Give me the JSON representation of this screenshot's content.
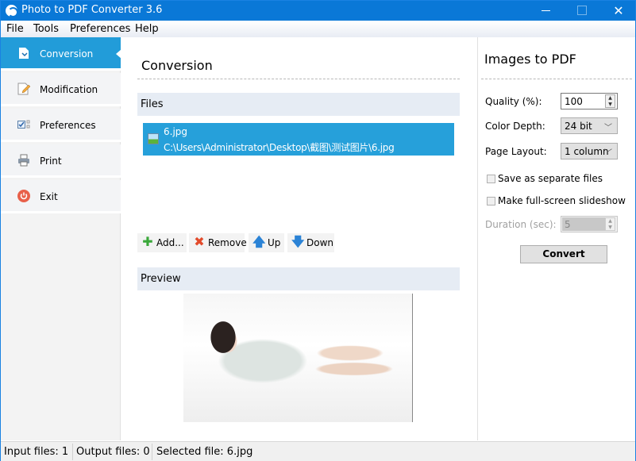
{
  "window": {
    "title": "Photo to PDF Converter 3.6",
    "controls": {
      "minimize": "minimize",
      "maximize": "maximize",
      "close": "✕"
    }
  },
  "menu": [
    "File",
    "Tools",
    "Preferences",
    "Help"
  ],
  "sidebar": {
    "items": [
      {
        "label": "Conversion",
        "icon": "document-convert-icon",
        "active": true
      },
      {
        "label": "Modification",
        "icon": "pencil-document-icon",
        "active": false
      },
      {
        "label": "Preferences",
        "icon": "checklist-icon",
        "active": false
      },
      {
        "label": "Print",
        "icon": "printer-icon",
        "active": false
      },
      {
        "label": "Exit",
        "icon": "power-icon",
        "active": false
      }
    ]
  },
  "main": {
    "title": "Conversion",
    "files_header": "Files",
    "files": [
      {
        "name": "6.jpg",
        "path": "C:\\Users\\Administrator\\Desktop\\截图\\测试图片\\6.jpg",
        "selected": true
      }
    ],
    "toolbar": {
      "add": "Add...",
      "remove": "Remove",
      "up": "Up",
      "down": "Down"
    },
    "preview_header": "Preview",
    "preview_alt": "Preview of 6.jpg"
  },
  "options": {
    "title": "Images to PDF",
    "quality_label": "Quality (%):",
    "quality_value": "100",
    "color_depth_label": "Color Depth:",
    "color_depth_value": "24 bit",
    "page_layout_label": "Page Layout:",
    "page_layout_value": "1 column",
    "save_separate_label": "Save as separate files",
    "save_separate_checked": false,
    "slideshow_label": "Make full-screen slideshow",
    "slideshow_checked": false,
    "duration_label": "Duration (sec):",
    "duration_value": "5",
    "convert_label": "Convert"
  },
  "status": {
    "input_files": "Input files: 1",
    "output_files": "Output files: 0",
    "selected_file": "Selected file: 6.jpg"
  }
}
